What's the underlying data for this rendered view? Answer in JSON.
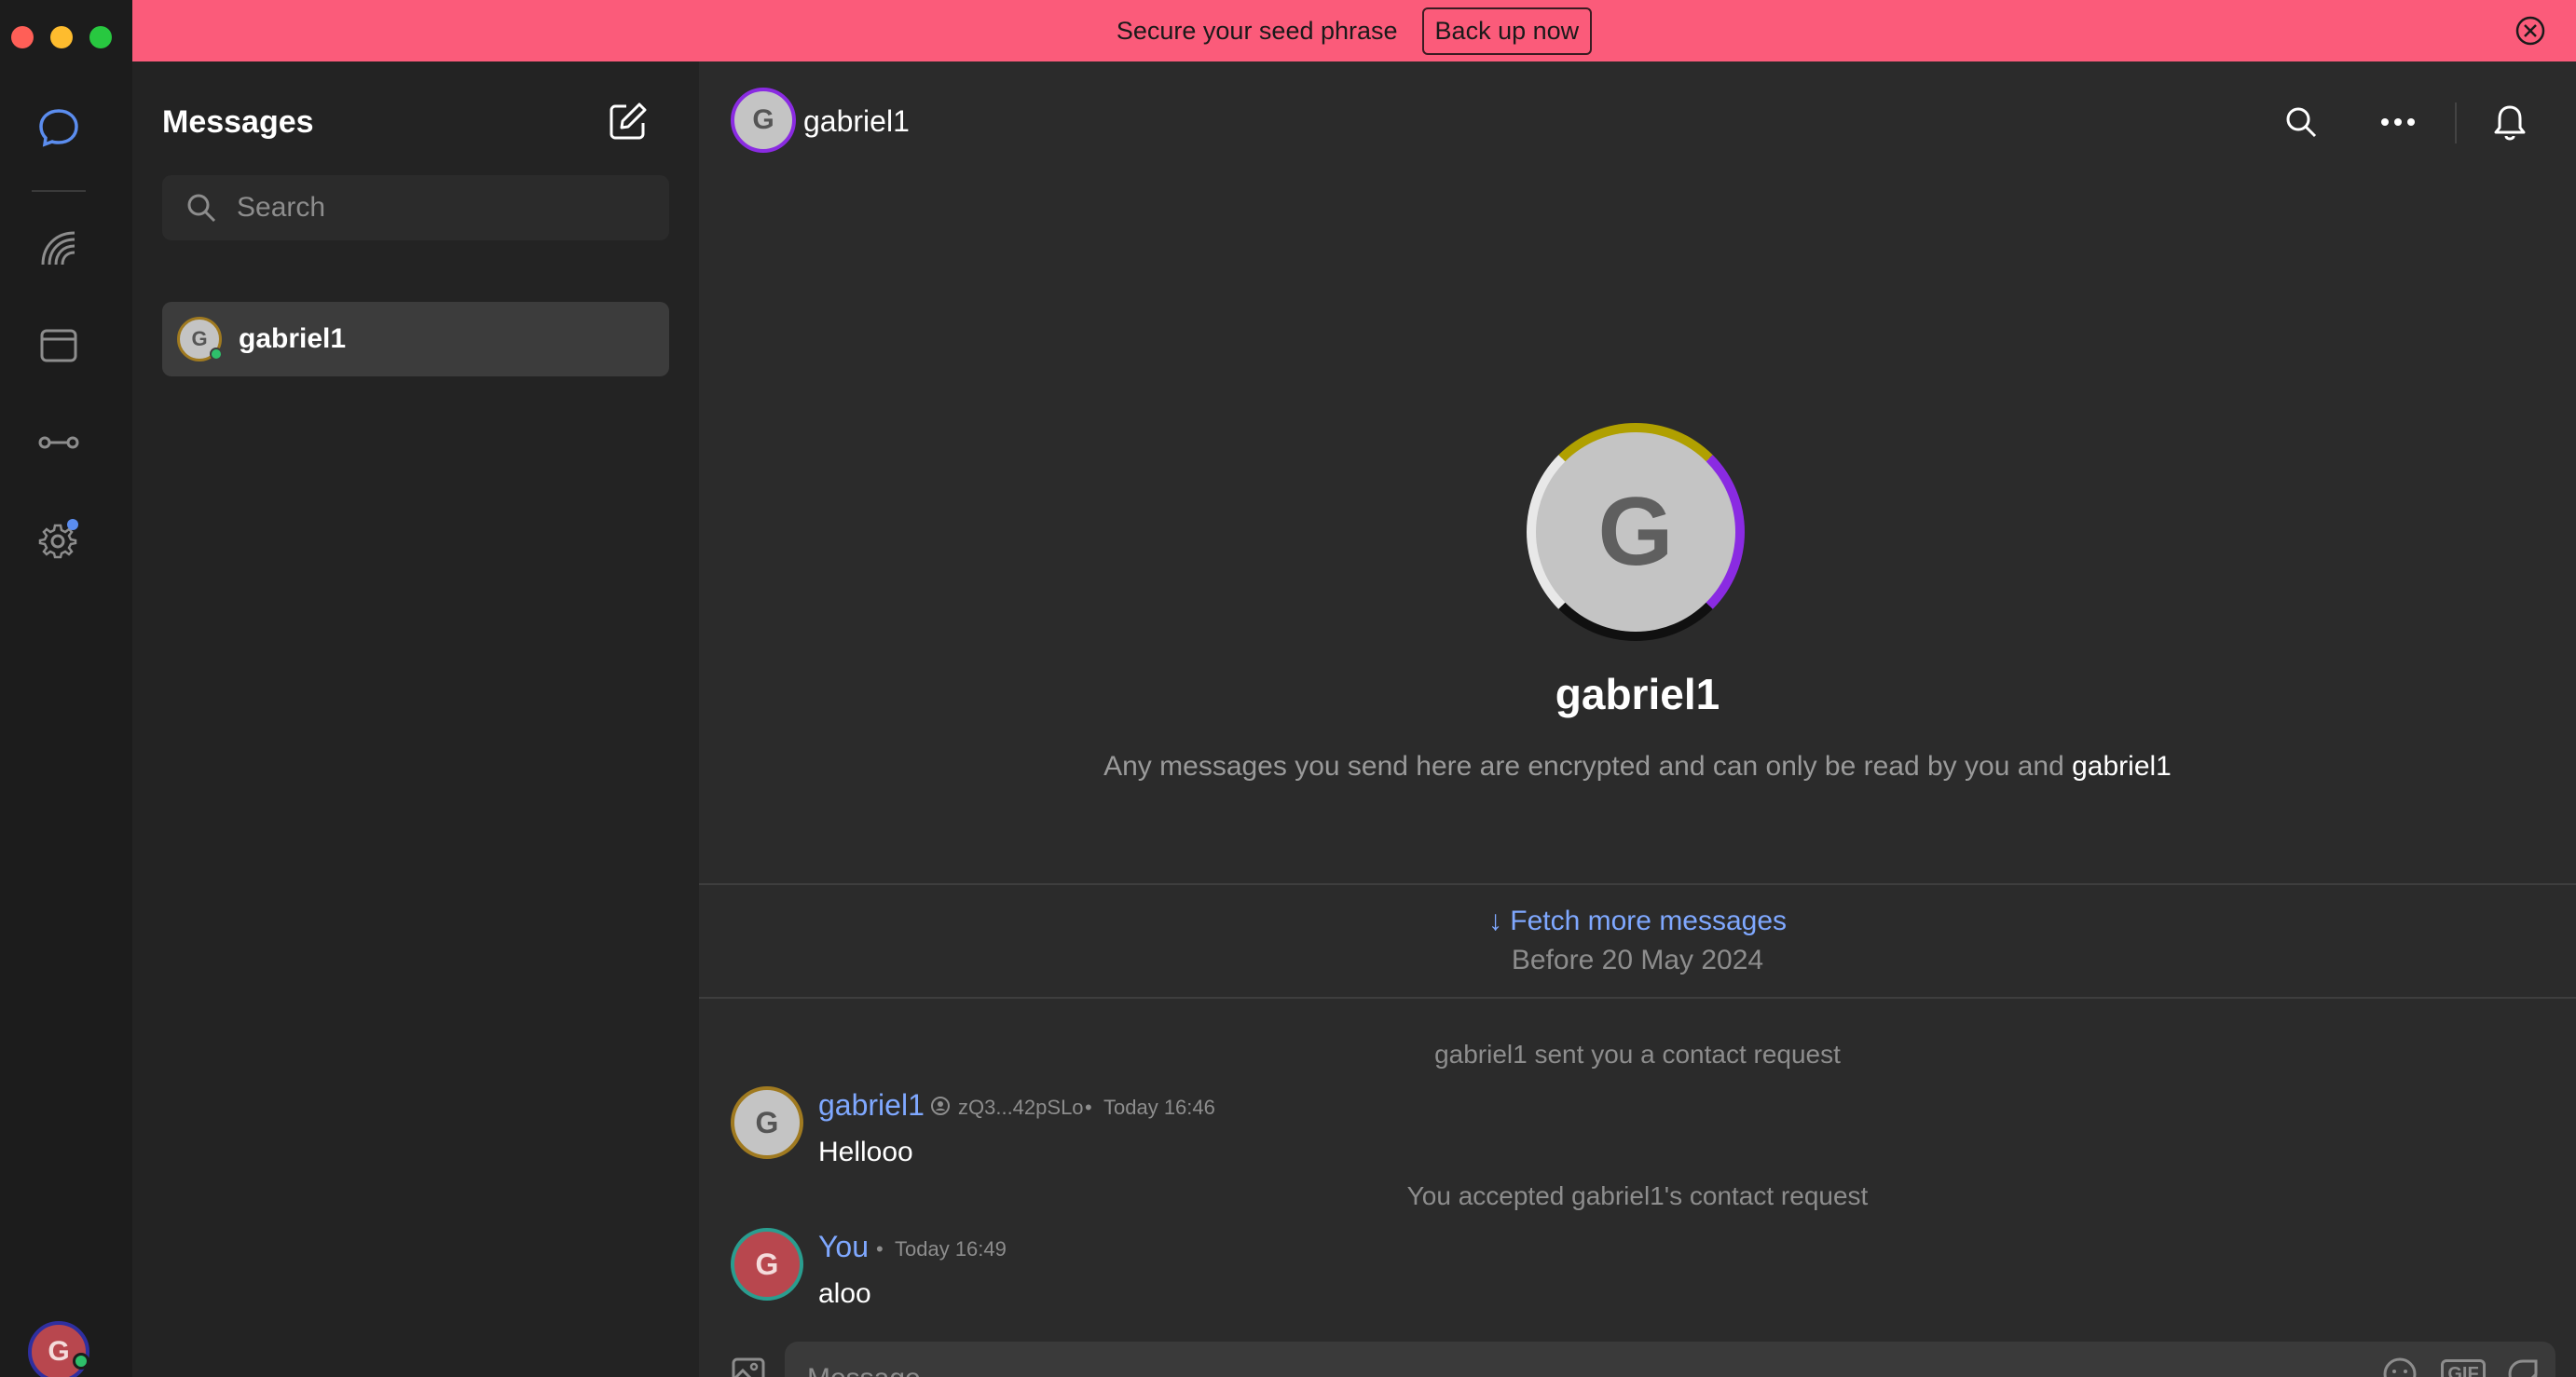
{
  "banner": {
    "text": "Secure your seed phrase",
    "button_label": "Back up now"
  },
  "rail": {
    "user_avatar_initial": "G"
  },
  "sidebar": {
    "title": "Messages",
    "search_placeholder": "Search",
    "conversations": [
      {
        "name": "gabriel1",
        "avatar_initial": "G",
        "online": true
      }
    ]
  },
  "chat": {
    "header_name": "gabriel1",
    "header_avatar_initial": "G",
    "intro": {
      "avatar_initial": "G",
      "name": "gabriel1",
      "text_prefix": "Any messages you send here are encrypted and can only be read by you and",
      "text_name": "gabriel1"
    },
    "fetch": {
      "link": "↓ Fetch more messages",
      "sub": "Before 20 May 2024"
    },
    "system_messages": [
      "gabriel1 sent you a contact request",
      "You accepted gabriel1's contact request"
    ],
    "messages": [
      {
        "author": "gabriel1",
        "key": "zQ3...42pSLo",
        "time": "Today 16:46",
        "body": "Hellooo",
        "avatar_initial": "G"
      },
      {
        "author": "You",
        "time": "Today 16:49",
        "body": "aloo",
        "avatar_initial": "G"
      }
    ],
    "composer_placeholder": "Message",
    "gif_label": "GIF"
  },
  "colors": {
    "banner": "#fb5b7a",
    "link": "#7fa8ff",
    "accent": "#5b8def",
    "online": "#2ebf6a"
  }
}
